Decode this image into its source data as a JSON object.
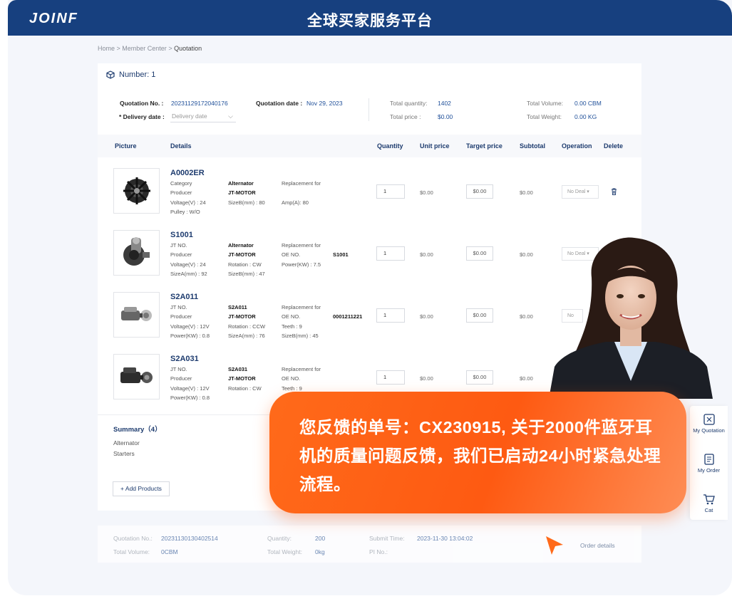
{
  "header": {
    "logo": "JOINF",
    "title": "全球买家服务平台"
  },
  "breadcrumb": {
    "home": "Home",
    "sep1": " > ",
    "member": "Member Center",
    "sep2": " > ",
    "current": "Quotation"
  },
  "panel": {
    "number_label": "Number: 1",
    "quotation_no_label": "Quotation No. :",
    "quotation_no": "20231129172040176",
    "quotation_date_label": "Quotation date :",
    "quotation_date": "Nov 29, 2023",
    "delivery_label": "* Delivery date :",
    "delivery_placeholder": "Delivery date",
    "total_quantity_label": "Total quantity:",
    "total_quantity": "1402",
    "total_price_label": "Total price :",
    "total_price": "$0.00",
    "total_volume_label": "Total Volume:",
    "total_volume": "0.00 CBM",
    "total_weight_label": "Total Weight:",
    "total_weight": "0.00 KG"
  },
  "table": {
    "headers": [
      "Picture",
      "Details",
      "Quantity",
      "Unit price",
      "Target price",
      "Subtotal",
      "Operation",
      "Delete"
    ],
    "rows": [
      {
        "code": "A0002ER",
        "c1": [
          "Category",
          "Producer",
          "Voltage(V) : 24",
          "Pulley : W/O"
        ],
        "c2": [
          "Alternator",
          "JT-MOTOR",
          "SizeB(mm) : 80"
        ],
        "c3": [
          "Replacement for",
          "",
          "Amp(A): 80"
        ],
        "c4": "",
        "qty": "1",
        "unit": "$0.00",
        "target": "$0.00",
        "subtotal": "$0.00",
        "op": "No Deal"
      },
      {
        "code": "S1001",
        "c1": [
          "JT NO.",
          "Producer",
          "Voltage(V) : 24",
          "SizeA(mm) : 92"
        ],
        "c2": [
          "Alternator",
          "JT-MOTOR",
          "Rotation : CW",
          "SizeB(mm) : 47"
        ],
        "c3": [
          "Replacement for",
          "OE NO.",
          "Power(KW) : 7.5"
        ],
        "c4": "S1001",
        "qty": "1",
        "unit": "$0.00",
        "target": "$0.00",
        "subtotal": "$0.00",
        "op": "No Deal"
      },
      {
        "code": "S2A011",
        "c1": [
          "JT NO.",
          "Producer",
          "Voltage(V) : 12V",
          "Power(KW) : 0.8"
        ],
        "c2": [
          "S2A011",
          "JT-MOTOR",
          "Rotation : CCW",
          "SizeA(mm) : 76"
        ],
        "c3": [
          "Replacement for",
          "OE NO.",
          "Teeth : 9",
          "SizeB(mm) : 45"
        ],
        "c4": "0001211221",
        "qty": "1",
        "unit": "$0.00",
        "target": "$0.00",
        "subtotal": "$0.00",
        "op": "No"
      },
      {
        "code": "S2A031",
        "c1": [
          "JT NO.",
          "Producer",
          "Voltage(V) : 12V",
          "Power(KW) : 0.8"
        ],
        "c2": [
          "S2A031",
          "JT-MOTOR",
          "Rotation : CW"
        ],
        "c3": [
          "Replacement for",
          "OE NO.",
          "Teeth : 9"
        ],
        "c4": "",
        "qty": "1",
        "unit": "$0.00",
        "target": "$0.00",
        "subtotal": "$0.00",
        "op": ""
      }
    ]
  },
  "summary": {
    "title": "Summary（4）",
    "items": [
      "Alternator",
      "Starters"
    ],
    "add_button": "+ Add Products"
  },
  "bottom": {
    "qno_label": "Quotation No.:",
    "qno": "20231130130402514",
    "qty_label": "Quantity:",
    "qty": "200",
    "submit_label": "Submit Time:",
    "submit": "2023-11-30 13:04:02",
    "vol_label": "Total Volume:",
    "vol": "0CBM",
    "weight_label": "Total Weight:",
    "weight": "0kg",
    "pi_label": "PI No.:",
    "order_details": "Order details"
  },
  "siderail": {
    "quotation": "My Quotation",
    "order": "My Order",
    "cart": "Cat"
  },
  "bubble": {
    "text": "您反馈的单号：CX230915, 关于2000件蓝牙耳机的质量问题反馈，我们已启动24小时紧急处理流程。"
  },
  "colors": {
    "header_bg": "#17407f",
    "accent_blue": "#1d3b6e",
    "bubble_orange": "#fe5a12"
  }
}
